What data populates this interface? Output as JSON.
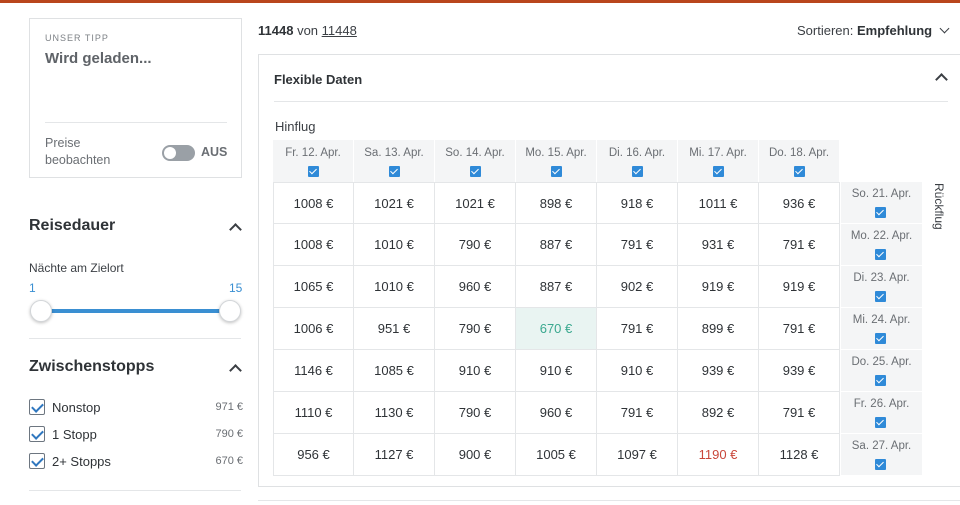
{
  "tip_card": {
    "eyebrow": "UNSER TIPP",
    "title": "Wird geladen...",
    "watch_label": "Preise beobachten",
    "toggle_state": "AUS"
  },
  "reisedauer": {
    "heading": "Reisedauer",
    "sub_label": "Nächte am Zielort",
    "range_min": "1",
    "range_max": "15"
  },
  "zwischenstopps": {
    "heading": "Zwischenstopps",
    "options": [
      {
        "label": "Nonstop",
        "price": "971 €"
      },
      {
        "label": "1 Stopp",
        "price": "790 €"
      },
      {
        "label": "2+ Stopps",
        "price": "670 €"
      }
    ]
  },
  "results": {
    "count": "11448",
    "of": "von",
    "total": "11448",
    "sort_label": "Sortieren:",
    "sort_value": "Empfehlung"
  },
  "flex_panel": {
    "title": "Flexible Daten",
    "outbound_label": "Hinflug",
    "return_label": "Rückflug",
    "outbound_dates": [
      "Fr. 12. Apr.",
      "Sa. 13. Apr.",
      "So. 14. Apr.",
      "Mo. 15. Apr.",
      "Di. 16. Apr.",
      "Mi. 17. Apr.",
      "Do. 18. Apr."
    ],
    "return_dates": [
      "So. 21. Apr.",
      "Mo. 22. Apr.",
      "Di. 23. Apr.",
      "Mi. 24. Apr.",
      "Do. 25. Apr.",
      "Fr. 26. Apr.",
      "Sa. 27. Apr."
    ],
    "prices": [
      [
        "1008 €",
        "1021 €",
        "1021 €",
        "898 €",
        "918 €",
        "1011 €",
        "936 €"
      ],
      [
        "1008 €",
        "1010 €",
        "790 €",
        "887 €",
        "791 €",
        "931 €",
        "791 €"
      ],
      [
        "1065 €",
        "1010 €",
        "960 €",
        "887 €",
        "902 €",
        "919 €",
        "919 €"
      ],
      [
        "1006 €",
        "951 €",
        "790 €",
        "670 €",
        "791 €",
        "899 €",
        "791 €"
      ],
      [
        "1146 €",
        "1085 €",
        "910 €",
        "910 €",
        "910 €",
        "939 €",
        "939 €"
      ],
      [
        "1110 €",
        "1130 €",
        "790 €",
        "960 €",
        "791 €",
        "892 €",
        "791 €"
      ],
      [
        "956 €",
        "1127 €",
        "900 €",
        "1005 €",
        "1097 €",
        "1190 €",
        "1128 €"
      ]
    ],
    "highlight_low_color": "#3aa88f",
    "highlight_high_color": "#c9473b"
  },
  "colors": {
    "accent": "#3a8fd2",
    "top_bar": "#b9461d"
  }
}
